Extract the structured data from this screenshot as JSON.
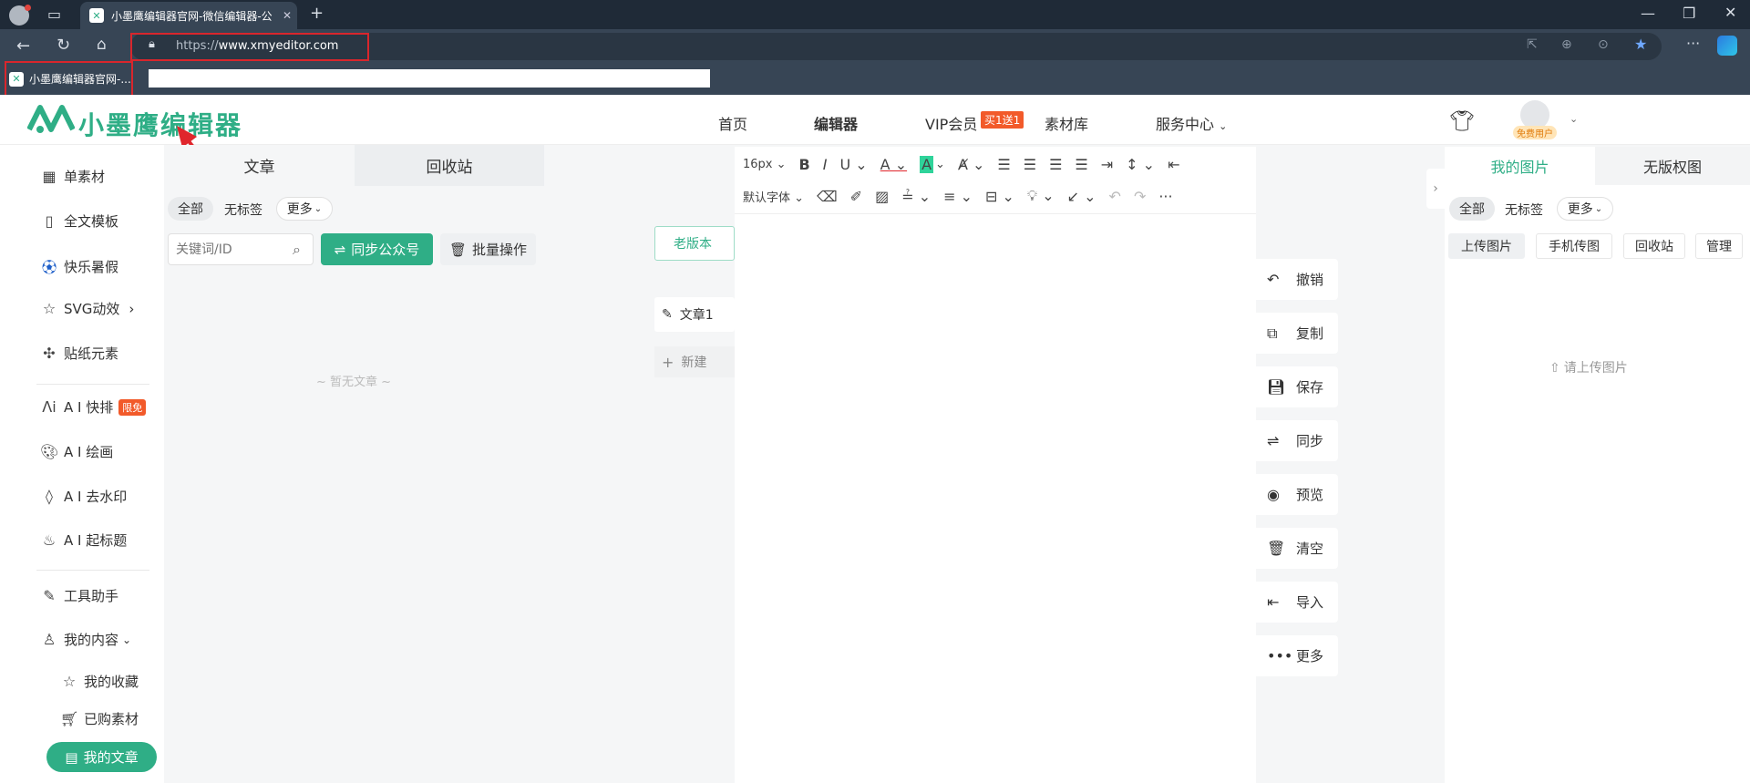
{
  "browser": {
    "tab_title": "小墨鹰编辑器官网-微信编辑器-公",
    "url_protocol": "https://",
    "url_domain": "www.xmyeditor.com",
    "favorite_label": "小墨鹰编辑器官网-..."
  },
  "header": {
    "logo": "小墨鹰编辑器",
    "nav": [
      "首页",
      "编辑器",
      "VIP会员",
      "素材库",
      "服务中心"
    ],
    "vip_badge": "买1送1",
    "user_badge": "免费用户"
  },
  "sidebar": {
    "items": [
      {
        "icon": "grid-icon",
        "label": "单素材"
      },
      {
        "icon": "template-icon",
        "label": "全文模板"
      },
      {
        "icon": "ball-icon",
        "label": "快乐暑假"
      },
      {
        "icon": "star-icon",
        "label": "SVG动效"
      },
      {
        "icon": "puzzle-icon",
        "label": "贴纸元素"
      },
      {
        "icon": "ai-icon",
        "label": "A I 快排"
      },
      {
        "icon": "palette-icon",
        "label": "A I 绘画"
      },
      {
        "icon": "drop-icon",
        "label": "A I 去水印"
      },
      {
        "icon": "fire-icon",
        "label": "A I 起标题"
      },
      {
        "icon": "tool-icon",
        "label": "工具助手"
      },
      {
        "icon": "user-icon",
        "label": "我的内容"
      },
      {
        "icon": "star-icon",
        "label": "我的收藏"
      },
      {
        "icon": "cart-icon",
        "label": "已购素材"
      },
      {
        "icon": "doc-icon",
        "label": "我的文章"
      }
    ],
    "ai_badge": "限免"
  },
  "articles": {
    "tabs": [
      "文章",
      "回收站"
    ],
    "filters": [
      "全部",
      "无标签",
      "更多"
    ],
    "search_placeholder": "关键词/ID",
    "sync_button": "同步公众号",
    "batch_button": "批量操作",
    "empty_text": "~ 暂无文章 ~"
  },
  "editor": {
    "old_version": "老版本",
    "doc_tab": "文章1",
    "new_tab": "新建",
    "font_size": "16px",
    "font_family": "默认字体",
    "side_actions": [
      "撤销",
      "复制",
      "保存",
      "同步",
      "预览",
      "清空",
      "导入",
      "更多"
    ]
  },
  "images": {
    "tabs": [
      "我的图片",
      "无版权图"
    ],
    "filters": [
      "全部",
      "无标签",
      "更多"
    ],
    "buttons": [
      "上传图片",
      "手机传图",
      "回收站",
      "管理"
    ],
    "empty_text": "请上传图片"
  },
  "colors": {
    "brand": "#2fae86",
    "accent": "#f25a2a",
    "chrome": "#374555"
  }
}
